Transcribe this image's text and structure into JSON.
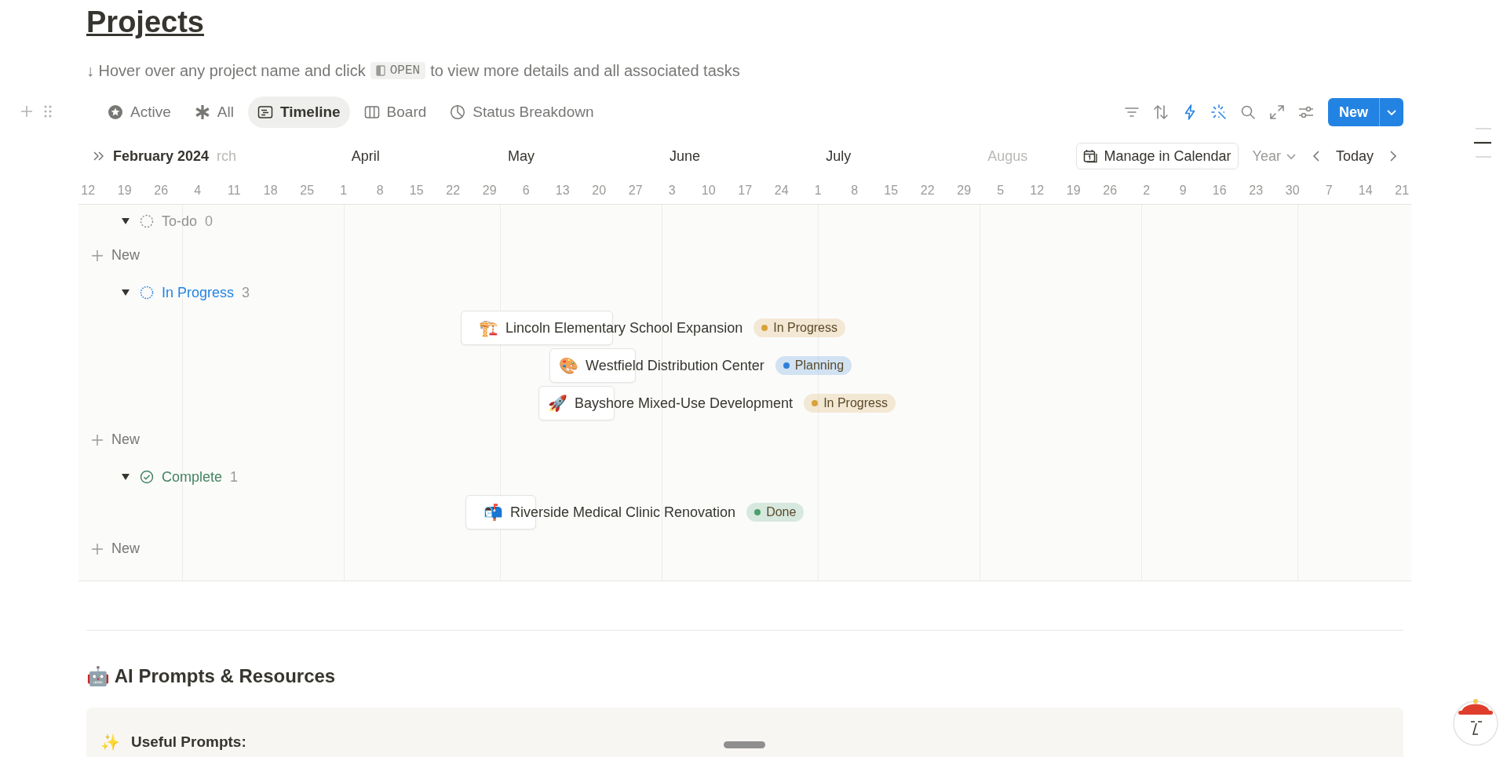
{
  "page": {
    "title": "Projects",
    "hint": {
      "before": "↓ Hover over any project name and click",
      "chip": "OPEN",
      "after": "to view more details and all associated tasks"
    }
  },
  "tabs": [
    {
      "label": "Active",
      "selected": false
    },
    {
      "label": "All",
      "selected": false
    },
    {
      "label": "Timeline",
      "selected": true
    },
    {
      "label": "Board",
      "selected": false
    },
    {
      "label": "Status Breakdown",
      "selected": false
    }
  ],
  "toolbar": {
    "tools": [
      {
        "active": false
      },
      {
        "active": false
      },
      {
        "active": true
      },
      {
        "active": true
      },
      {
        "active": false
      },
      {
        "active": false
      },
      {
        "active": false
      }
    ],
    "new_button": "New"
  },
  "timeline": {
    "period": "February 2024",
    "months": [
      "rch",
      "April",
      "May",
      "June",
      "July",
      "Augus"
    ],
    "dates": [
      "12",
      "19",
      "26",
      "4",
      "11",
      "18",
      "25",
      "1",
      "8",
      "15",
      "22",
      "29",
      "6",
      "13",
      "20",
      "27",
      "3",
      "10",
      "17",
      "24",
      "1",
      "8",
      "15",
      "22",
      "29",
      "5",
      "12",
      "19",
      "26",
      "2",
      "9",
      "16",
      "23",
      "30",
      "7",
      "14",
      "21"
    ],
    "calendar_button": "Manage in Calendar",
    "scale": "Year",
    "today_button": "Today",
    "groups": [
      {
        "kind": "todo",
        "label": "To-do",
        "count": "0",
        "expanded": true,
        "color": "#91918e",
        "new_label": "New"
      },
      {
        "kind": "in_progress",
        "label": "In Progress",
        "count": "3",
        "expanded": true,
        "color": "#2383e2",
        "new_label": "New",
        "items": [
          {
            "emoji": "🏗️",
            "name": "Lincoln Elementary School Expansion",
            "status": {
              "label": "In Progress",
              "color": "#d9a23a"
            }
          },
          {
            "emoji": "🎨",
            "name": "Westfield Distribution Center",
            "status": {
              "label": "Planning",
              "color": "#2f80d8"
            }
          },
          {
            "emoji": "🚀",
            "name": "Bayshore Mixed-Use Development",
            "status": {
              "label": "In Progress",
              "color": "#d9a23a"
            }
          }
        ]
      },
      {
        "kind": "complete",
        "label": "Complete",
        "count": "1",
        "expanded": true,
        "color": "#448361",
        "new_label": "New",
        "items": [
          {
            "emoji": "📬",
            "name": "Riverside Medical Clinic Renovation",
            "status": {
              "label": "Done",
              "color": "#4c9f6e"
            }
          }
        ]
      }
    ]
  },
  "section": {
    "heading": "🤖 AI Prompts & Resources",
    "callout_icon": "✨",
    "callout_title": "Useful Prompts:"
  }
}
